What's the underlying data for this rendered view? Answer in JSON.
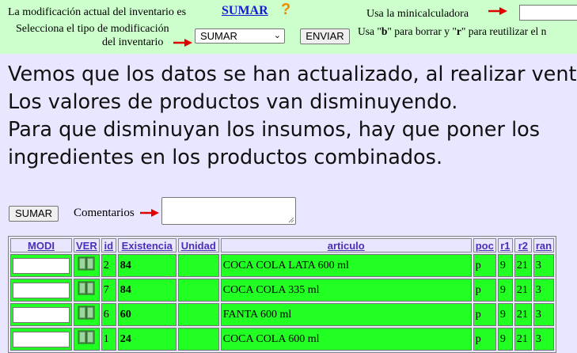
{
  "header": {
    "mod_label": "La modificación actual del inventario es",
    "current_mod": "SUMAR",
    "help": "?",
    "calc_label": "Usa la minicalculadora",
    "calc_help_prefix": "Usa \"",
    "calc_help_b": "b",
    "calc_help_middle": "\" para borrar y \"",
    "calc_help_r": "r",
    "calc_help_suffix": "\" para reutilizar el n",
    "select_label_1": "Selecciona el tipo de modificación",
    "select_label_2": "del inventario",
    "select_value": "SUMAR",
    "enviar": "ENVIAR"
  },
  "message": [
    "Vemos que los datos se han actualizado, al realizar ventas",
    "Los valores de productos van disminuyendo.",
    "Para que disminuyan los insumos, hay que poner los",
    "ingredientes en los productos combinados."
  ],
  "form": {
    "sumar_button": "SUMAR",
    "comment_label": "Comentarios"
  },
  "table": {
    "headers": [
      "MODI",
      "VER",
      "id",
      "Existencia",
      "Unidad",
      "articulo",
      "poc",
      "r1",
      "r2",
      "ran"
    ],
    "rows": [
      {
        "id": "2",
        "existencia": "84",
        "unidad": "",
        "articulo": "COCA COLA LATA 600 ml",
        "poc": "p",
        "r1": "9",
        "r2": "21",
        "ran": "3"
      },
      {
        "id": "7",
        "existencia": "84",
        "unidad": "",
        "articulo": "COCA COLA 335 ml",
        "poc": "p",
        "r1": "9",
        "r2": "21",
        "ran": "3"
      },
      {
        "id": "6",
        "existencia": "60",
        "unidad": "",
        "articulo": "FANTA 600 ml",
        "poc": "p",
        "r1": "9",
        "r2": "21",
        "ran": "3"
      },
      {
        "id": "1",
        "existencia": "24",
        "unidad": "",
        "articulo": "COCA COLA 600 ml",
        "poc": "p",
        "r1": "9",
        "r2": "21",
        "ran": "3"
      }
    ]
  },
  "icons": {
    "arrow": "red-arrow-icon",
    "book": "book-icon",
    "help": "question-mark-icon"
  },
  "colors": {
    "page_bg": "#e9e6ff",
    "header_bg": "#ccffcc",
    "row_bg": "#22ff22",
    "link": "#1a1ad6",
    "header_text": "#4b2fb8",
    "arrow": "#e00000"
  }
}
